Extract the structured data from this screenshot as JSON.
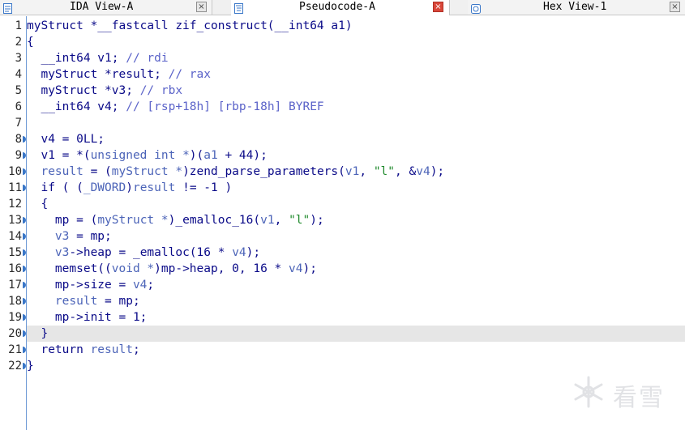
{
  "tabs": [
    {
      "label": "IDA View-A",
      "active": false,
      "icon": "document-icon"
    },
    {
      "label": "Pseudocode-A",
      "active": true,
      "icon": "pseudocode-icon"
    },
    {
      "label": "Hex View-1",
      "active": false,
      "icon": "hex-icon"
    }
  ],
  "colors": {
    "accent": "#3a77c8",
    "highlight": "#e6e6e6",
    "string": "#1f8a2c",
    "comment": "#5b63c9"
  },
  "code": {
    "lines": [
      {
        "n": "1",
        "dot": false,
        "tokens": [
          {
            "t": "myStruct *__fastcall zif_construct(__int64 a1)",
            "c": "t-id"
          }
        ]
      },
      {
        "n": "2",
        "dot": false,
        "tokens": [
          {
            "t": "{",
            "c": "t-id"
          }
        ]
      },
      {
        "n": "3",
        "dot": false,
        "tokens": [
          {
            "t": "  __int64 v1; ",
            "c": "t-id"
          },
          {
            "t": "// rdi",
            "c": "t-cmt"
          }
        ]
      },
      {
        "n": "4",
        "dot": false,
        "tokens": [
          {
            "t": "  myStruct *result; ",
            "c": "t-id"
          },
          {
            "t": "// rax",
            "c": "t-cmt"
          }
        ]
      },
      {
        "n": "5",
        "dot": false,
        "tokens": [
          {
            "t": "  myStruct *v3; ",
            "c": "t-id"
          },
          {
            "t": "// rbx",
            "c": "t-cmt"
          }
        ]
      },
      {
        "n": "6",
        "dot": false,
        "tokens": [
          {
            "t": "  __int64 v4; ",
            "c": "t-id"
          },
          {
            "t": "// [rsp+18h] [rbp-18h] BYREF",
            "c": "t-cmt"
          }
        ]
      },
      {
        "n": "7",
        "dot": false,
        "tokens": []
      },
      {
        "n": "8",
        "dot": true,
        "tokens": [
          {
            "t": "  v4 = 0LL;",
            "c": "t-id"
          }
        ]
      },
      {
        "n": "9",
        "dot": true,
        "tokens": [
          {
            "t": "  v1 = *(",
            "c": "t-id"
          },
          {
            "t": "unsigned int *",
            "c": "t-cast"
          },
          {
            "t": ")(",
            "c": "t-id"
          },
          {
            "t": "a1",
            "c": "t-var"
          },
          {
            "t": " + 44);",
            "c": "t-id"
          }
        ]
      },
      {
        "n": "10",
        "dot": true,
        "tokens": [
          {
            "t": "  result",
            "c": "t-var"
          },
          {
            "t": " = (",
            "c": "t-id"
          },
          {
            "t": "myStruct *",
            "c": "t-cast"
          },
          {
            "t": ")zend_parse_parameters(",
            "c": "t-id"
          },
          {
            "t": "v1",
            "c": "t-var"
          },
          {
            "t": ", ",
            "c": "t-id"
          },
          {
            "t": "\"l\"",
            "c": "t-str"
          },
          {
            "t": ", &",
            "c": "t-id"
          },
          {
            "t": "v4",
            "c": "t-var"
          },
          {
            "t": ");",
            "c": "t-id"
          }
        ]
      },
      {
        "n": "11",
        "dot": true,
        "tokens": [
          {
            "t": "  if ( (",
            "c": "t-id"
          },
          {
            "t": "_DWORD",
            "c": "t-cast"
          },
          {
            "t": ")",
            "c": "t-id"
          },
          {
            "t": "result",
            "c": "t-var"
          },
          {
            "t": " != -1 )",
            "c": "t-id"
          }
        ]
      },
      {
        "n": "12",
        "dot": false,
        "tokens": [
          {
            "t": "  {",
            "c": "t-id"
          }
        ]
      },
      {
        "n": "13",
        "dot": true,
        "tokens": [
          {
            "t": "    mp = (",
            "c": "t-id"
          },
          {
            "t": "myStruct *",
            "c": "t-cast"
          },
          {
            "t": ")_emalloc_16(",
            "c": "t-id"
          },
          {
            "t": "v1",
            "c": "t-var"
          },
          {
            "t": ", ",
            "c": "t-id"
          },
          {
            "t": "\"l\"",
            "c": "t-str"
          },
          {
            "t": ");",
            "c": "t-id"
          }
        ]
      },
      {
        "n": "14",
        "dot": true,
        "tokens": [
          {
            "t": "    v3",
            "c": "t-var"
          },
          {
            "t": " = mp;",
            "c": "t-id"
          }
        ]
      },
      {
        "n": "15",
        "dot": true,
        "tokens": [
          {
            "t": "    v3",
            "c": "t-var"
          },
          {
            "t": "->heap = _emalloc(16 * ",
            "c": "t-id"
          },
          {
            "t": "v4",
            "c": "t-var"
          },
          {
            "t": ");",
            "c": "t-id"
          }
        ]
      },
      {
        "n": "16",
        "dot": true,
        "tokens": [
          {
            "t": "    memset((",
            "c": "t-id"
          },
          {
            "t": "void *",
            "c": "t-cast"
          },
          {
            "t": ")mp->heap, 0, 16 * ",
            "c": "t-id"
          },
          {
            "t": "v4",
            "c": "t-var"
          },
          {
            "t": ");",
            "c": "t-id"
          }
        ]
      },
      {
        "n": "17",
        "dot": true,
        "tokens": [
          {
            "t": "    mp->size = ",
            "c": "t-id"
          },
          {
            "t": "v4",
            "c": "t-var"
          },
          {
            "t": ";",
            "c": "t-id"
          }
        ]
      },
      {
        "n": "18",
        "dot": true,
        "tokens": [
          {
            "t": "    result",
            "c": "t-var"
          },
          {
            "t": " = mp;",
            "c": "t-id"
          }
        ]
      },
      {
        "n": "19",
        "dot": true,
        "tokens": [
          {
            "t": "    mp->init = 1;",
            "c": "t-id"
          }
        ]
      },
      {
        "n": "20",
        "dot": true,
        "highlight": true,
        "tokens": [
          {
            "t": "  }",
            "c": "t-id"
          }
        ]
      },
      {
        "n": "21",
        "dot": true,
        "tokens": [
          {
            "t": "  return ",
            "c": "t-id"
          },
          {
            "t": "result",
            "c": "t-var"
          },
          {
            "t": ";",
            "c": "t-id"
          }
        ]
      },
      {
        "n": "22",
        "dot": true,
        "tokens": [
          {
            "t": "}",
            "c": "t-id"
          }
        ]
      }
    ]
  },
  "watermark": {
    "text": "看雪",
    "icon": "snowflake-icon"
  }
}
